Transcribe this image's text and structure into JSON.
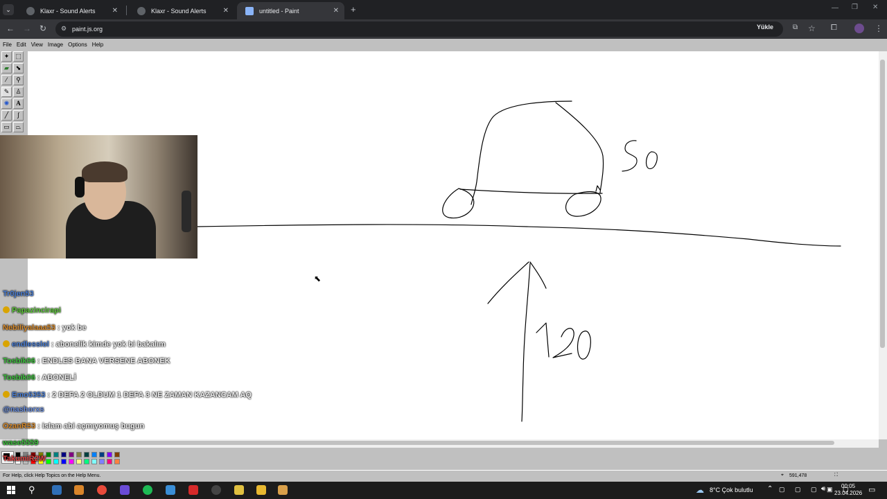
{
  "browser": {
    "tabs": [
      {
        "title": "Klaxr - Sound Alerts",
        "active": false
      },
      {
        "title": "Klaxr - Sound Alerts",
        "active": false
      },
      {
        "title": "untitled - Paint",
        "active": true
      }
    ],
    "new_tab_label": "+",
    "url": "paint.js.org",
    "install_label": "Yükle"
  },
  "paint": {
    "menu": [
      "File",
      "Edit",
      "View",
      "Image",
      "Options",
      "Help"
    ],
    "canvas_text_right": "50",
    "canvas_text_bottom": "120",
    "status_help": "For Help, click Help Topics on the Help Menu.",
    "status_coords": "591,478",
    "palette_colors": [
      "#000000",
      "#808080",
      "#800000",
      "#808000",
      "#008000",
      "#008080",
      "#000080",
      "#800080",
      "#808040",
      "#004040",
      "#0080ff",
      "#004080",
      "#8000ff",
      "#804000",
      "#ffffff",
      "#c0c0c0",
      "#ff0000",
      "#ffff00",
      "#00ff00",
      "#00ffff",
      "#0000ff",
      "#ff00ff",
      "#ffff80",
      "#00ff80",
      "#80ffff",
      "#8080ff",
      "#ff0080",
      "#ff8040"
    ]
  },
  "chat": [
    {
      "user": "Tr0jen53",
      "text": "",
      "color": "#4a7fd6",
      "badge": false
    },
    {
      "user": "Papazincirapi",
      "text": "",
      "color": "#5fc93b",
      "badge": true
    },
    {
      "user": "Nebiliyalaaa53",
      "text": "yok be",
      "color": "#d88a2a",
      "badge": false
    },
    {
      "user": "endlesslol",
      "text": "abonelik kimde yok bi bakalım",
      "color": "#4a7fd6",
      "badge": true
    },
    {
      "user": "Tosbik06",
      "text": "ENDLES BANA VERSENE ABONEK",
      "color": "#3ec13e",
      "badge": false
    },
    {
      "user": "Tosbik06",
      "text": "ABONELİ",
      "color": "#3ec13e",
      "badge": false
    },
    {
      "user": "Emo5353",
      "text": "2 DEFA 2 OLDUM 1 DEFA 3 NE ZAMAN KAZANCAM AQ",
      "color": "#4a7fd6",
      "badge": true
    },
    {
      "user": "@nashorxs",
      "text": "",
      "color": "#6a8fe0",
      "badge": false
    },
    {
      "user": "OzanR53",
      "text": "islam abi açmıyomuş bugun",
      "color": "#d88a2a",
      "badge": false
    },
    {
      "user": "wase5559",
      "text": "",
      "color": "#3ec13e",
      "badge": false
    },
    {
      "user": "TakumiR2W",
      "text": "",
      "color": "#e04040",
      "badge": false
    }
  ],
  "taskbar": {
    "weather": "8°C  Çok bulutlu",
    "time": "00:05",
    "date": "23.04.2026"
  }
}
